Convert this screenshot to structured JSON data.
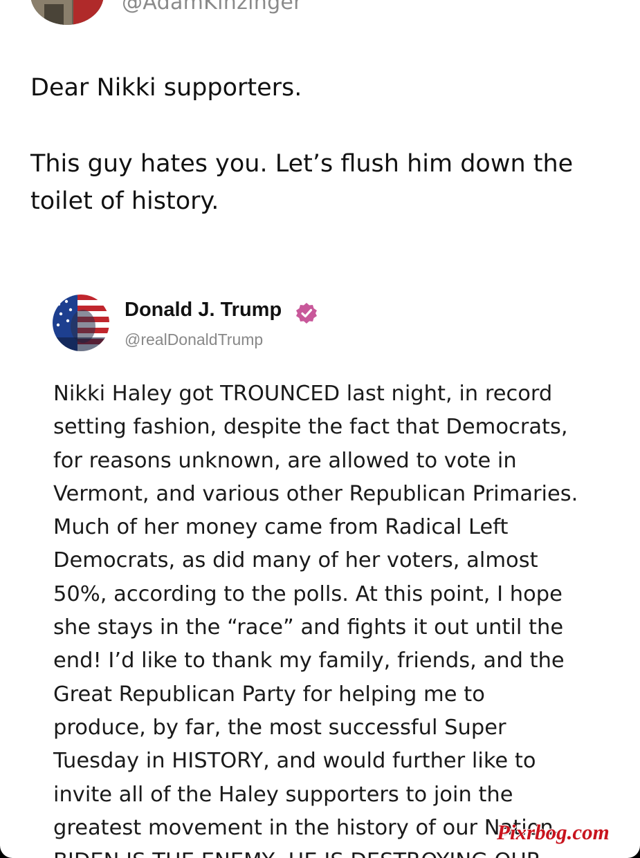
{
  "colors": {
    "background": "#ffffff",
    "text": "#111111",
    "handle": "#888888",
    "verified_badge": "#c8589a",
    "watermark": "#c8141e"
  },
  "post": {
    "author_handle": "@AdamKinzinger",
    "author_avatar_icon": "profile-photo",
    "text_lines": [
      "Dear Nikki supporters.",
      "This guy hates you.  Let’s flush him down the",
      "toilet of history."
    ]
  },
  "quoted_post": {
    "avatar_icon": "flag-portrait-avatar",
    "display_name": "Donald J. Trump",
    "verified_icon": "verified-badge-icon",
    "handle": "@realDonaldTrump",
    "body_lines": [
      "Nikki Haley got TROUNCED last night, in record",
      "setting fashion, despite the fact that Democrats,",
      "for reasons unknown, are allowed to vote in",
      "Vermont, and various other Republican Primaries.",
      "Much of her money came from Radical Left",
      "Democrats, as did many of her voters, almost",
      "50%, according to the polls. At this point, I hope",
      "she stays in the “race” and fights it out until the",
      "end! I’d like to thank my family, friends, and the",
      "Great Republican Party for helping me to",
      "produce, by far, the most successful Super",
      "Tuesday in HISTORY, and would further like to",
      "invite all of the Haley supporters to join the",
      "greatest movement in the history of our Nation.",
      "BIDEN IS THE ENEMY, HE IS DESTROYING OUR"
    ]
  },
  "watermark": "Pixrbog.com"
}
